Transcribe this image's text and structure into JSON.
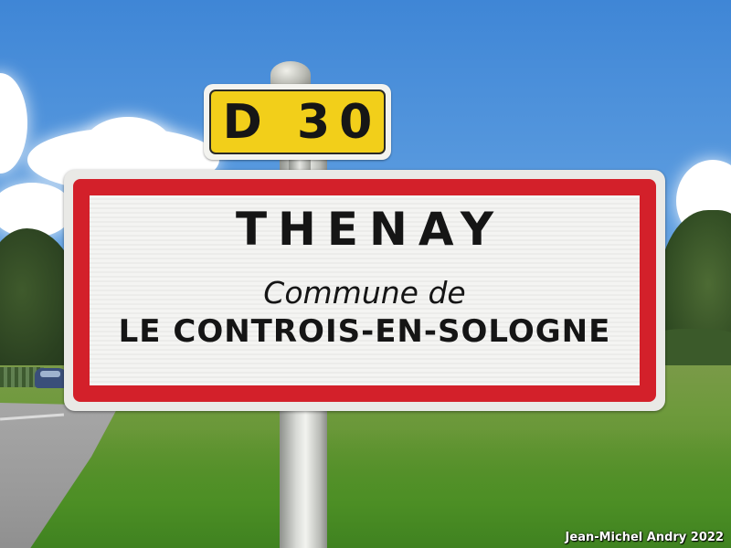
{
  "route_sign": {
    "text": "D 30",
    "background_color": "#f2cf1a"
  },
  "town_sign": {
    "name": "THENAY",
    "line1": "Commune de",
    "line2": "LE CONTROIS-EN-SOLOGNE",
    "border_color": "#d3202a"
  },
  "credit": "Jean-Michel Andry 2022"
}
